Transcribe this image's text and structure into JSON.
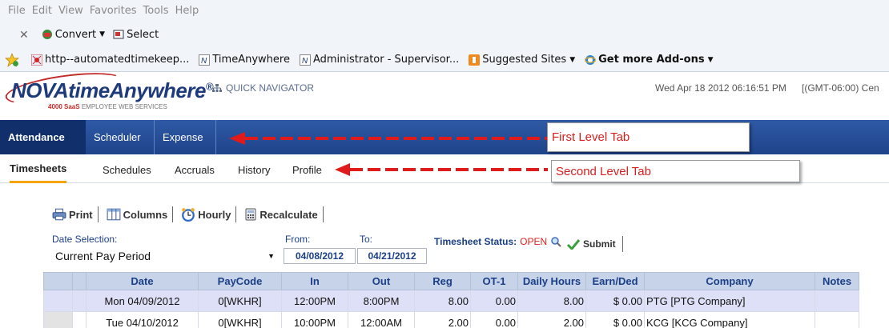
{
  "browser": {
    "menu": [
      "File",
      "Edit",
      "View",
      "Favorites",
      "Tools",
      "Help"
    ],
    "commands": [
      {
        "label": "Convert",
        "icon": "convert-icon",
        "dropdown": true
      },
      {
        "label": "Select",
        "icon": "select-icon",
        "dropdown": false
      }
    ],
    "favorites": [
      {
        "label": "http--automatedtimekeep...",
        "icon": "web-slice-icon"
      },
      {
        "label": "TimeAnywhere",
        "icon": "novatime-icon"
      },
      {
        "label": "Administrator - Supervisor...",
        "icon": "novatime-icon"
      },
      {
        "label": "Suggested Sites",
        "icon": "suggested-sites-icon"
      },
      {
        "label": "Get more Add-ons",
        "icon": "ie-icon"
      }
    ]
  },
  "app": {
    "logo_main": "NOVAtimeAnywhere",
    "logo_reg": "®",
    "logo_sub_brand": "4000 SaaS",
    "logo_sub_text": "EMPLOYEE WEB SERVICES",
    "quick_nav": "QUICK NAVIGATOR",
    "datetime": "Wed Apr 18 2012 06:16:51 PM",
    "timezone": "[(GMT-06:00) Cen"
  },
  "tabs_first": [
    "Attendance",
    "Scheduler",
    "Expense"
  ],
  "tabs_second": [
    "Timesheets",
    "Schedules",
    "Accruals",
    "History",
    "Profile"
  ],
  "annotations": {
    "first": "First Level Tab",
    "second": "Second Level Tab"
  },
  "toolbar": {
    "print": "Print",
    "columns": "Columns",
    "hourly": "Hourly",
    "recalculate": "Recalculate"
  },
  "date_selection": {
    "label": "Date Selection:",
    "value": "Current Pay Period",
    "from_label": "From:",
    "from": "04/08/2012",
    "to_label": "To:",
    "to": "04/21/2012"
  },
  "timesheet": {
    "status_label": "Timesheet Status:",
    "status_value": "OPEN",
    "submit": "Submit"
  },
  "grid": {
    "columns": [
      "Date",
      "PayCode",
      "In",
      "Out",
      "Reg",
      "OT-1",
      "Daily Hours",
      "Earn/Ded",
      "Company",
      "Notes"
    ],
    "rows": [
      [
        "Mon 04/09/2012",
        "0[WKHR]",
        "12:00PM",
        "8:00PM",
        "8.00",
        "0.00",
        "8.00",
        "$ 0.00",
        "PTG [PTG Company]",
        ""
      ],
      [
        "Tue 04/10/2012",
        "0[WKHR]",
        "10:00PM",
        "12:00AM",
        "2.00",
        "0.00",
        "2.00",
        "$ 0.00",
        "KCG [KCG Company]",
        ""
      ]
    ]
  },
  "colors": {
    "nav_blue": "#2f5aa6",
    "nav_active": "#102f6b",
    "tab_underline": "#f4a300",
    "annotation_red": "#d81e1e",
    "label_blue": "#1b3f86"
  }
}
